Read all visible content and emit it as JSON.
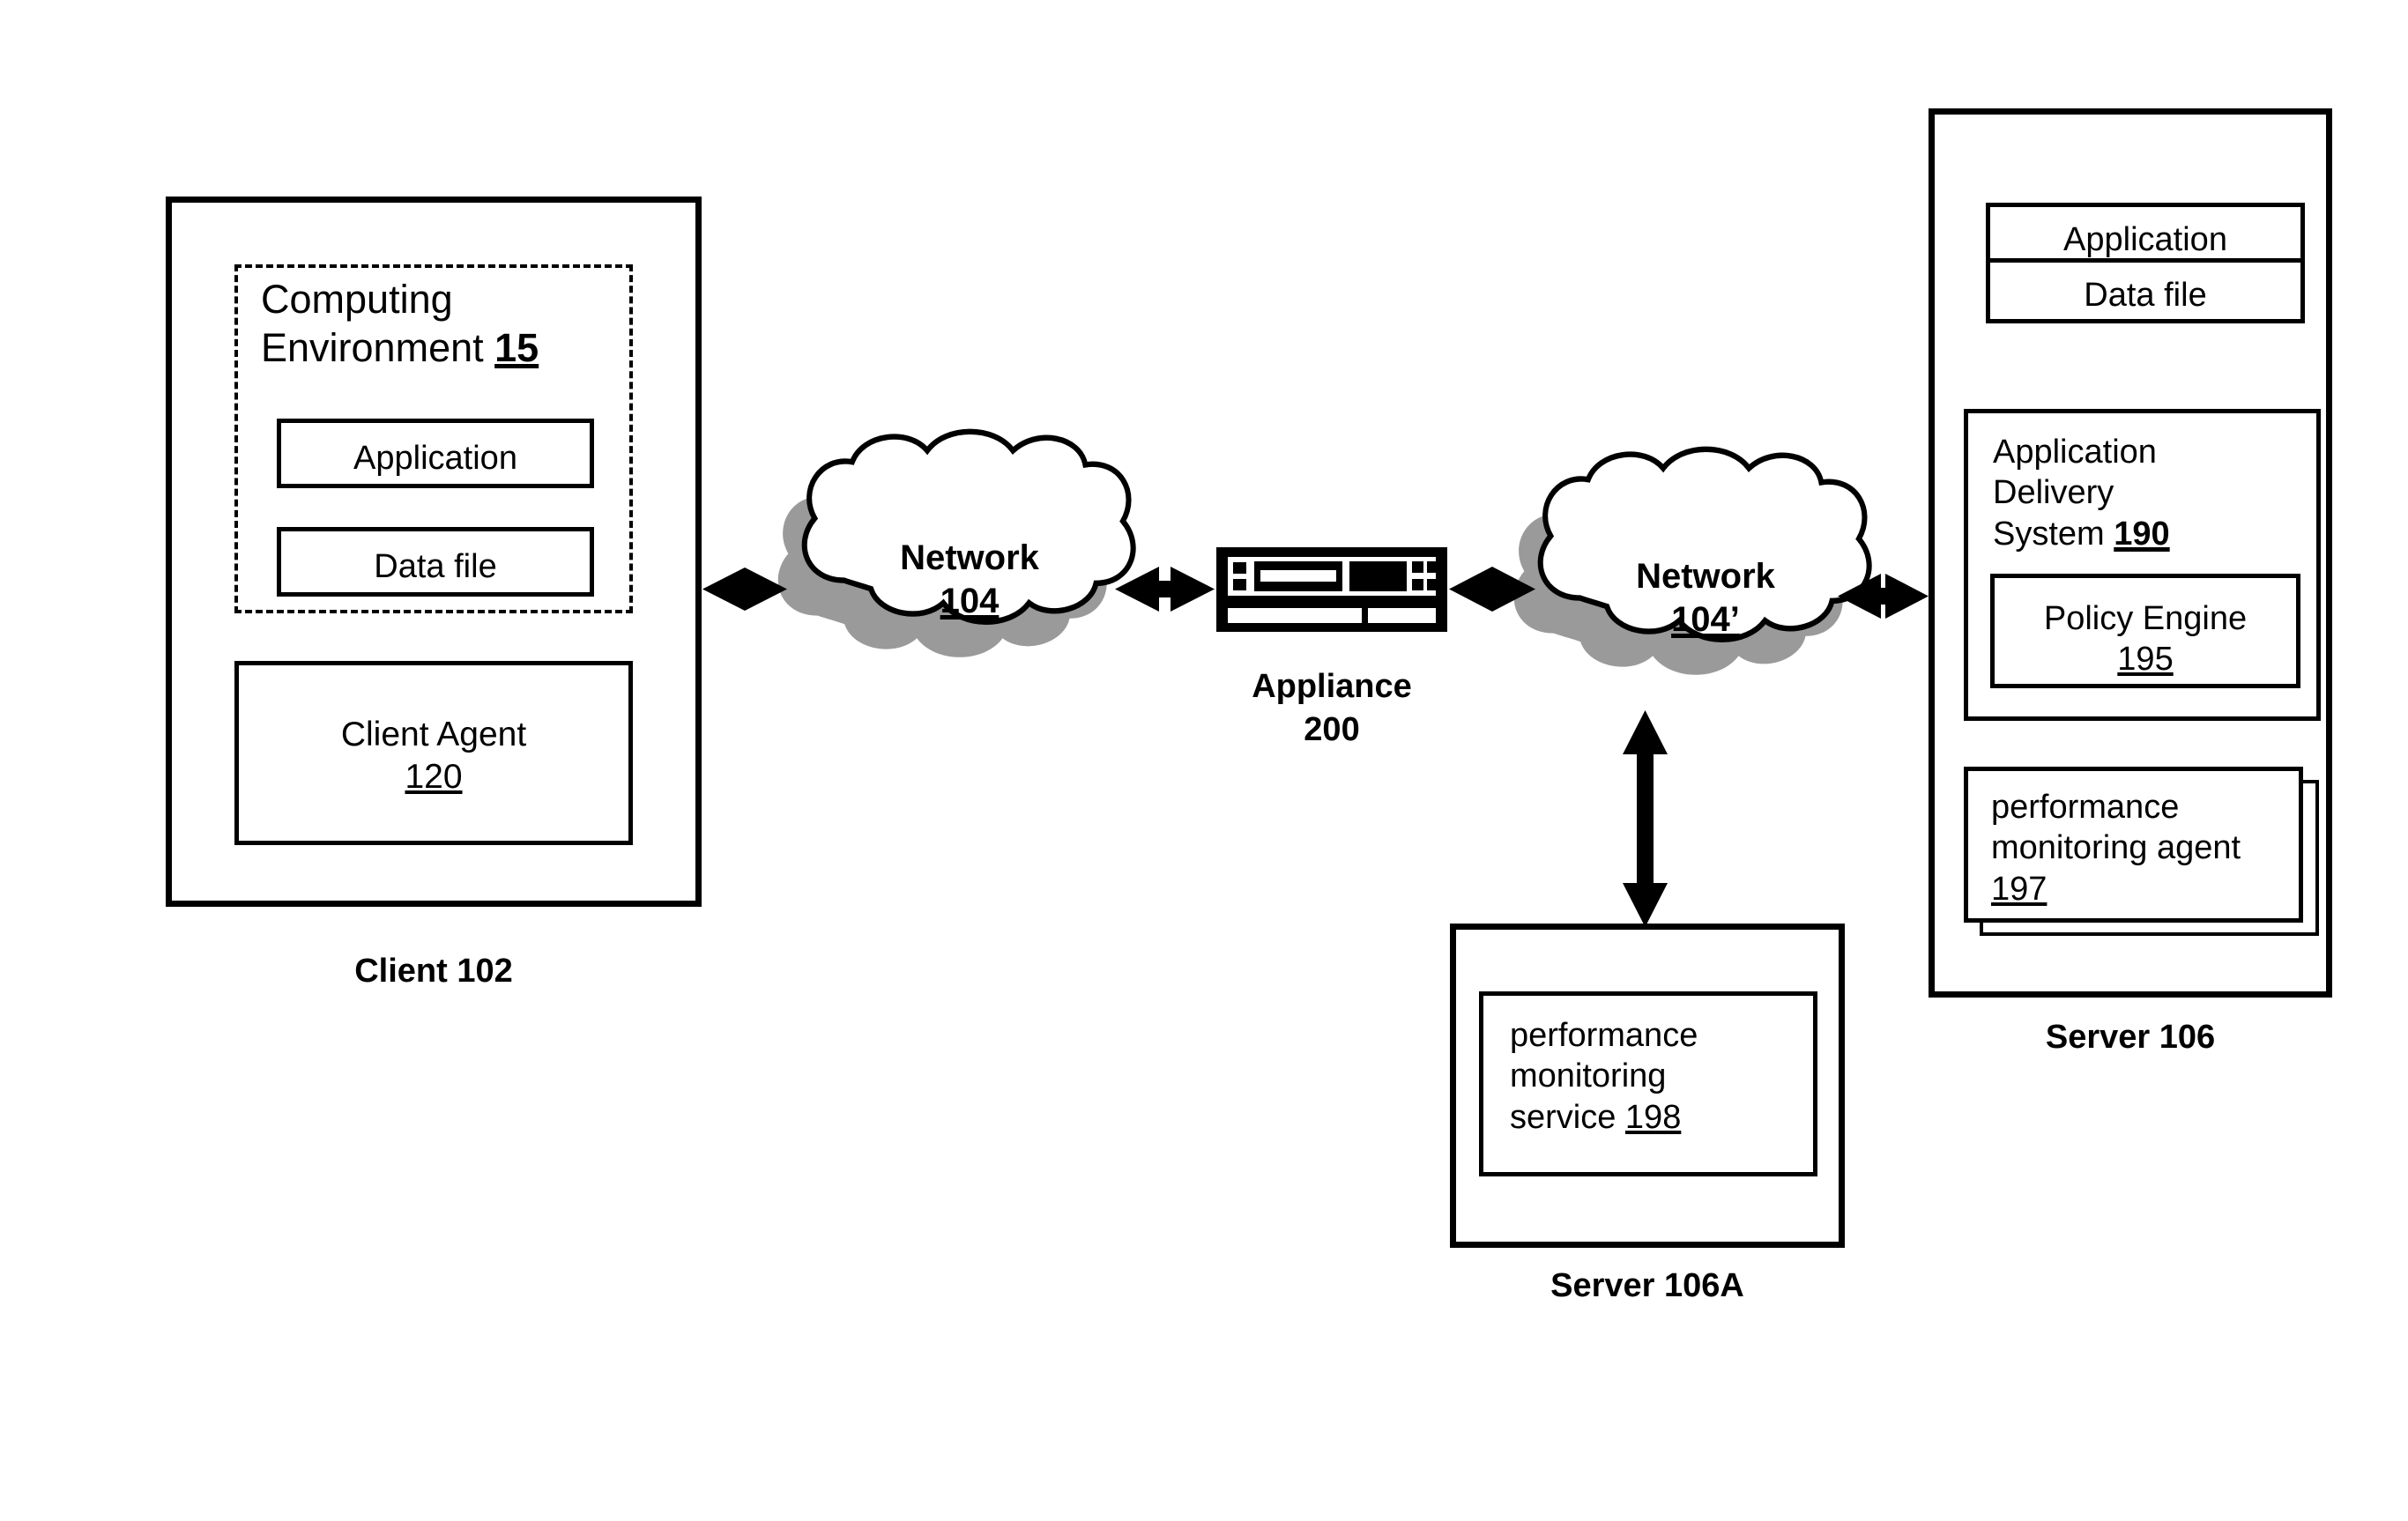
{
  "figure": {
    "type": "network-architecture-diagram",
    "background": "#ffffff",
    "ink": "#000000",
    "shadow_color": "#9a9a9a"
  },
  "client": {
    "caption": "Client 102",
    "computing_environment": {
      "title_line1": "Computing",
      "title_line2": "Environment ",
      "title_number": "15",
      "application_label": "Application",
      "data_file_label": "Data file"
    },
    "client_agent": {
      "label": "Client Agent",
      "number": "120"
    }
  },
  "network_left": {
    "label": "Network",
    "number": "104"
  },
  "appliance": {
    "caption_line1": "Appliance",
    "caption_line2": "200"
  },
  "network_right": {
    "label": "Network",
    "number": "104’"
  },
  "server_106": {
    "caption": "Server 106",
    "application_label": "Application",
    "data_file_label": "Data file",
    "application_delivery_system": {
      "line1": "Application",
      "line2": "Delivery",
      "line3": "System ",
      "number": "190",
      "policy_engine": {
        "label": "Policy Engine",
        "number": "195"
      }
    },
    "performance_monitoring_agent": {
      "line1": "performance",
      "line2": "monitoring agent",
      "number": "197"
    }
  },
  "server_106a": {
    "caption": "Server 106A",
    "performance_monitoring_service": {
      "line1": "performance",
      "line2": "monitoring",
      "line3": "service ",
      "number": "198"
    }
  },
  "connectors": [
    {
      "name": "client-to-network-104",
      "style": "double-headed-arrow",
      "orientation": "horizontal"
    },
    {
      "name": "network-104-to-appliance",
      "style": "double-headed-arrow",
      "orientation": "horizontal"
    },
    {
      "name": "appliance-to-network-104-prime",
      "style": "double-headed-arrow",
      "orientation": "horizontal"
    },
    {
      "name": "network-104-prime-to-server-106",
      "style": "double-headed-arrow",
      "orientation": "horizontal"
    },
    {
      "name": "network-104-prime-to-server-106a",
      "style": "double-headed-arrow",
      "orientation": "vertical"
    }
  ]
}
